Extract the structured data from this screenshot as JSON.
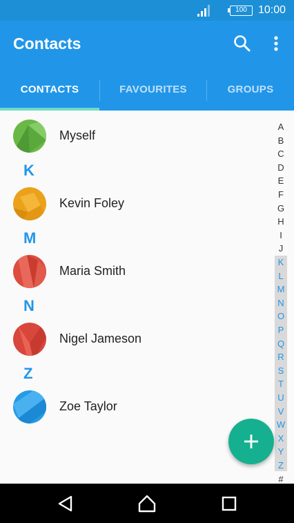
{
  "status_bar": {
    "battery": "100",
    "time": "10:00"
  },
  "app_bar": {
    "title": "Contacts",
    "search_icon": "search-icon",
    "more_icon": "more-vert-icon"
  },
  "tabs": [
    {
      "label": "CONTACTS",
      "selected": true
    },
    {
      "label": "FAVOURITES",
      "selected": false
    },
    {
      "label": "GROUPS",
      "selected": false
    }
  ],
  "sections": [
    {
      "letter": "",
      "contacts": [
        {
          "name": "Myself",
          "avatar_color": "#6ab946"
        }
      ]
    },
    {
      "letter": "K",
      "contacts": [
        {
          "name": "Kevin Foley",
          "avatar_color": "#eba21a"
        }
      ]
    },
    {
      "letter": "M",
      "contacts": [
        {
          "name": "Maria Smith",
          "avatar_color": "#dd4d3f"
        }
      ]
    },
    {
      "letter": "N",
      "contacts": [
        {
          "name": "Nigel Jameson",
          "avatar_color": "#d9473c"
        }
      ]
    },
    {
      "letter": "Z",
      "contacts": [
        {
          "name": "Zoe Taylor",
          "avatar_color": "#259be6"
        }
      ]
    }
  ],
  "index": [
    "A",
    "B",
    "C",
    "D",
    "E",
    "F",
    "G",
    "H",
    "I",
    "J",
    "K",
    "L",
    "M",
    "N",
    "O",
    "P",
    "Q",
    "R",
    "S",
    "T",
    "U",
    "V",
    "W",
    "X",
    "Y",
    "Z",
    "#"
  ],
  "fab": {
    "icon": "plus-icon"
  },
  "nav": {
    "back": "back-icon",
    "home": "home-icon",
    "recents": "recents-icon"
  },
  "colors": {
    "status_bar": "#1c8fd6",
    "app_bar": "#2196e9",
    "tab_indicator": "#6fdcc4",
    "accent": "#2196e9",
    "fab": "#15b08f"
  }
}
